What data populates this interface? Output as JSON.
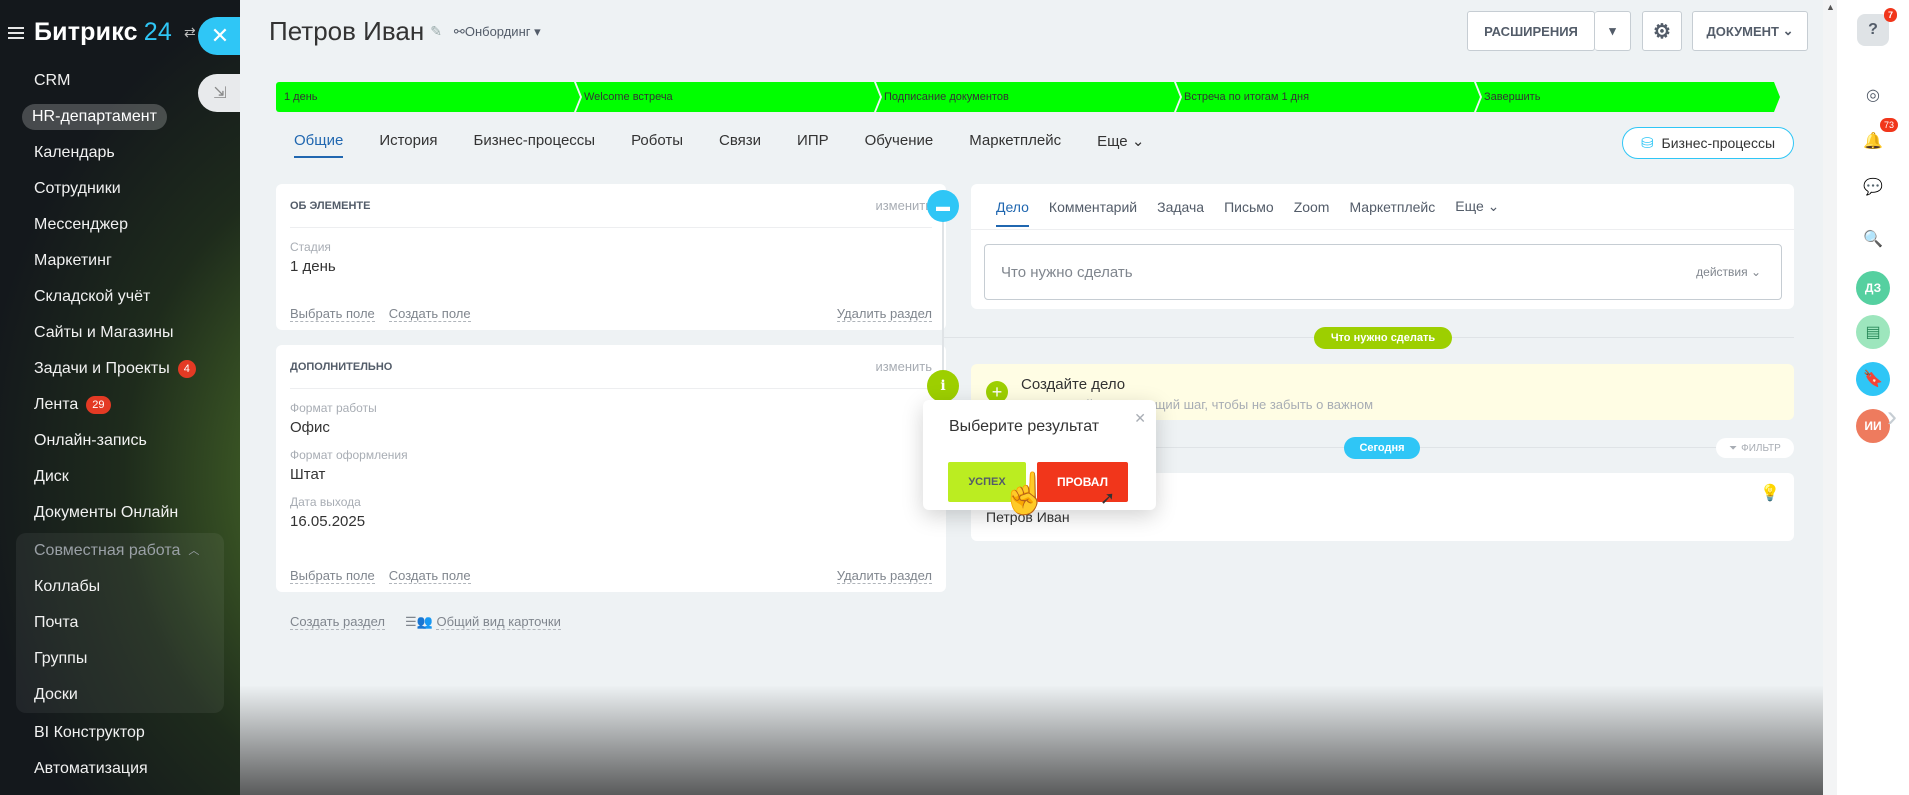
{
  "sidebar": {
    "logo_text": "Битрикс",
    "logo_number": "24",
    "items": [
      {
        "label": "CRM",
        "counter": ""
      },
      {
        "label": "HR-департамент",
        "counter": ""
      },
      {
        "label": "Календарь",
        "counter": ""
      },
      {
        "label": "Сотрудники",
        "counter": ""
      },
      {
        "label": "Мессенджер",
        "counter": ""
      },
      {
        "label": "Маркетинг",
        "counter": ""
      },
      {
        "label": "Складской учёт",
        "counter": ""
      },
      {
        "label": "Сайты и Магазины",
        "counter": ""
      },
      {
        "label": "Задачи и Проекты",
        "counter": "4"
      },
      {
        "label": "Лента",
        "counter": "29"
      },
      {
        "label": "Онлайн-запись",
        "counter": ""
      },
      {
        "label": "Диск",
        "counter": ""
      },
      {
        "label": "Документы Онлайн",
        "counter": ""
      }
    ],
    "group": {
      "title": "Совместная работа",
      "items": [
        "Коллабы",
        "Почта",
        "Группы",
        "Доски"
      ]
    },
    "items_after": [
      "BI Конструктор",
      "Автоматизация"
    ]
  },
  "header": {
    "title": "Петров Иван",
    "category": "Онбординг",
    "extensions_label": "РАСШИРЕНИЯ",
    "document_label": "ДОКУМЕНТ"
  },
  "stages": [
    "1 день",
    "Welcome встреча",
    "Подписание документов",
    "Встреча по итогам 1 дня",
    "Завершить"
  ],
  "stage_color": "#00ff00",
  "tabs": [
    "Общие",
    "История",
    "Бизнес-процессы",
    "Роботы",
    "Связи",
    "ИПР",
    "Обучение",
    "Маркетплейс",
    "Еще"
  ],
  "bp_button": "Бизнес-процессы",
  "about_card": {
    "title": "ОБ ЭЛЕМЕНТЕ",
    "edit": "изменить",
    "fields": [
      {
        "label": "Стадия",
        "value": "1 день"
      }
    ],
    "select_field": "Выбрать поле",
    "create_field": "Создать поле",
    "delete_section": "Удалить раздел"
  },
  "extra_card": {
    "title": "ДОПОЛНИТЕЛЬНО",
    "edit": "изменить",
    "fields": [
      {
        "label": "Формат работы",
        "value": "Офис"
      },
      {
        "label": "Формат оформления",
        "value": "Штат"
      },
      {
        "label": "Дата выхода",
        "value": "16.05.2025"
      }
    ],
    "select_field": "Выбрать поле",
    "create_field": "Создать поле",
    "delete_section": "Удалить раздел"
  },
  "below_cards": {
    "create_section": "Создать раздел",
    "card_view": "Общий вид карточки"
  },
  "activity": {
    "tabs": [
      "Дело",
      "Комментарий",
      "Задача",
      "Письмо",
      "Zoom",
      "Маркетплейс",
      "Еще"
    ],
    "placeholder": "Что нужно сделать",
    "actions": "действия"
  },
  "timeline": {
    "todo_pill": "Что нужно сделать",
    "create_title": "Создайте дело",
    "create_hint": "Запланируйте следующий шаг, чтобы не забыть о важном",
    "today_pill": "Сегодня",
    "filter": "ФИЛЬТР",
    "entry_name": "Петров Иван"
  },
  "popup": {
    "title": "Выберите результат",
    "success": "УСПЕХ",
    "fail": "ПРОВАЛ"
  },
  "right_rail": {
    "help_badge": "7",
    "notif_badge": "73",
    "avatar1": "ДЗ",
    "avatar2": "ИИ"
  }
}
